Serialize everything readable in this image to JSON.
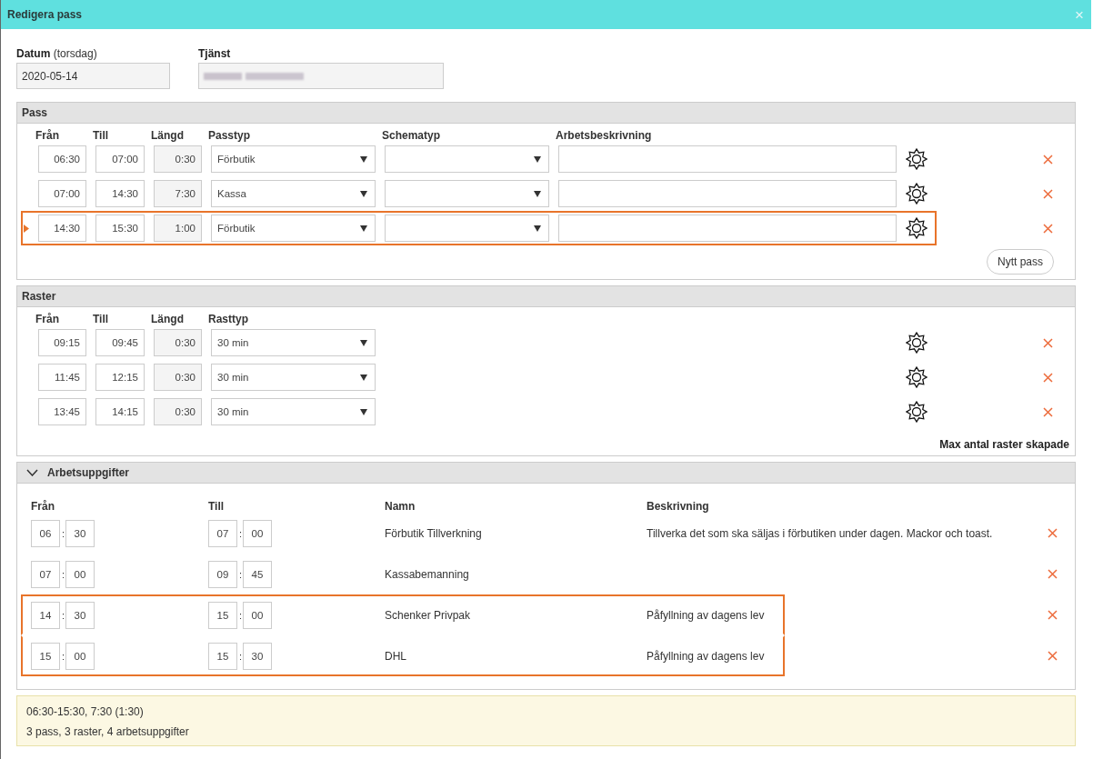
{
  "dialog": {
    "title": "Redigera pass",
    "close": "×"
  },
  "date": {
    "label": "Datum",
    "hint": "(torsdag)",
    "value": "2020-05-14"
  },
  "service": {
    "label": "Tjänst"
  },
  "pass": {
    "title": "Pass",
    "columns": [
      "Från",
      "Till",
      "Längd",
      "Passtyp",
      "Schematyp",
      "Arbetsbeskrivning"
    ],
    "rows": [
      {
        "from": "06:30",
        "to": "07:00",
        "length": "0:30",
        "type": "Förbutik",
        "selected": false
      },
      {
        "from": "07:00",
        "to": "14:30",
        "length": "7:30",
        "type": "Kassa",
        "selected": false
      },
      {
        "from": "14:30",
        "to": "15:30",
        "length": "1:00",
        "type": "Förbutik",
        "selected": true
      }
    ],
    "new_button": "Nytt pass"
  },
  "breaks": {
    "title": "Raster",
    "columns": [
      "Från",
      "Till",
      "Längd",
      "Rasttyp"
    ],
    "rows": [
      {
        "from": "09:15",
        "to": "09:45",
        "length": "0:30",
        "type": "30 min"
      },
      {
        "from": "11:45",
        "to": "12:15",
        "length": "0:30",
        "type": "30 min"
      },
      {
        "from": "13:45",
        "to": "14:15",
        "length": "0:30",
        "type": "30 min"
      }
    ],
    "note": "Max antal raster skapade"
  },
  "tasks": {
    "title": "Arbetsuppgifter",
    "expanded": true,
    "columns": [
      "Från",
      "Till",
      "Namn",
      "Beskrivning"
    ],
    "rows": [
      {
        "from": {
          "hour": "06",
          "sep": ":",
          "minute": "30"
        },
        "to": {
          "hour": "07",
          "sep": ":",
          "minute": "00"
        },
        "name": "Förbutik Tillverkning",
        "description": "Tillverka det som ska säljas i förbutiken under dagen. Mackor och toast.",
        "highlighted": false
      },
      {
        "from": {
          "hour": "07",
          "sep": ":",
          "minute": "00"
        },
        "to": {
          "hour": "09",
          "sep": ":",
          "minute": "45"
        },
        "name": "Kassabemanning",
        "highlighted": false
      },
      {
        "from": {
          "hour": "14",
          "sep": ":",
          "minute": "30"
        },
        "to": {
          "hour": "15",
          "sep": ":",
          "minute": "00"
        },
        "name": "Schenker Privpak",
        "description": "Påfyllning av dagens lev",
        "highlighted": true
      },
      {
        "from": {
          "hour": "15",
          "sep": ":",
          "minute": "00"
        },
        "to": {
          "hour": "15",
          "sep": ":",
          "minute": "30"
        },
        "name": "DHL",
        "description": "Påfyllning av dagens lev",
        "highlighted": true
      }
    ]
  },
  "summary": [
    "06:30-15:30, 7:30 (1:30)",
    "3 pass, 3 raster, 4 arbetsuppgifter"
  ]
}
